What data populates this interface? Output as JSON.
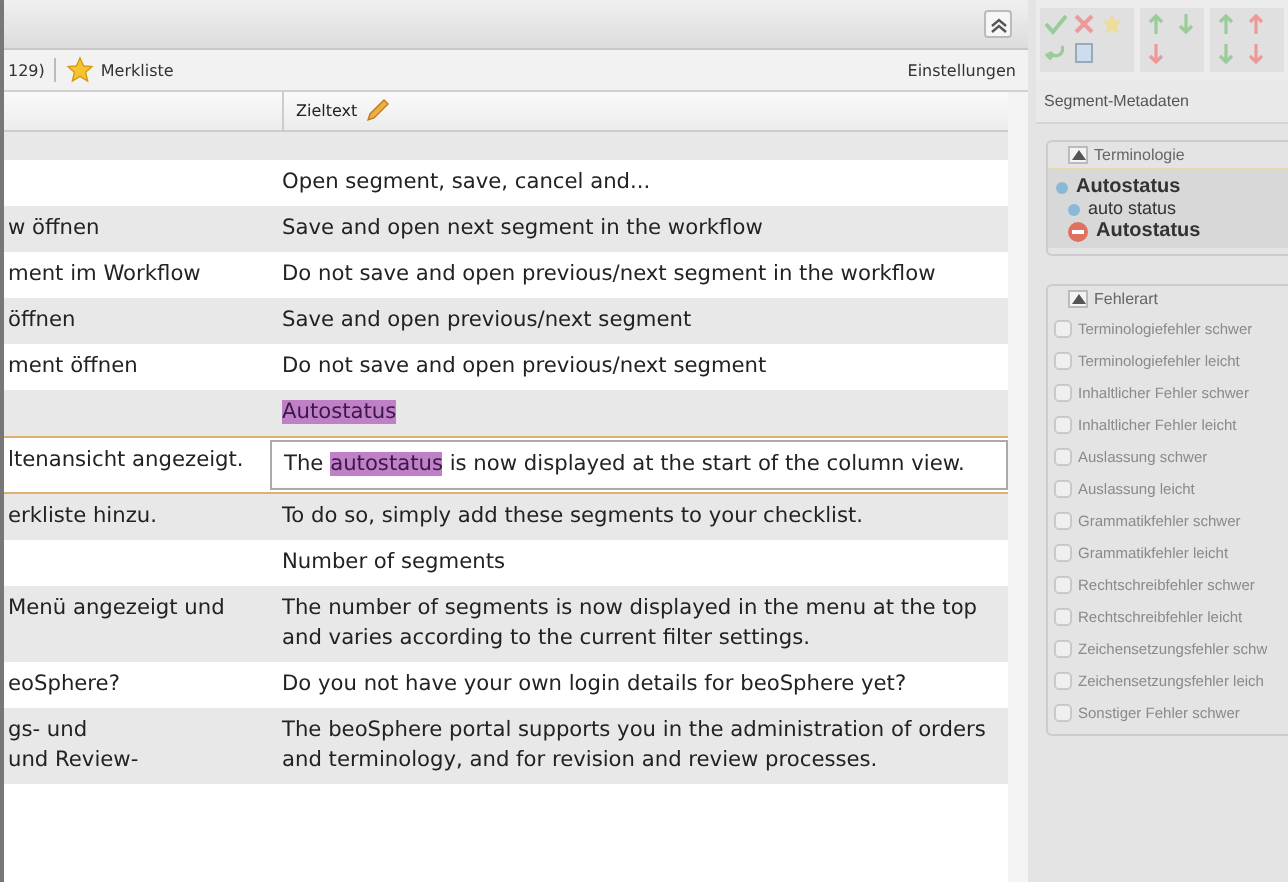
{
  "toolbar": {
    "count": "129)",
    "bookmark": "Merkliste",
    "settings": "Einstellungen"
  },
  "table": {
    "target_header": "Zieltext",
    "rows": [
      {
        "source": [],
        "target": [
          [
            {
              "text": "Open segment, save, cancel and...",
              "highlight": false
            }
          ]
        ],
        "selected": false
      },
      {
        "source": [
          "w öffnen"
        ],
        "target": [
          [
            {
              "text": "Save and open next segment in the workflow",
              "highlight": false
            }
          ]
        ],
        "selected": false
      },
      {
        "source": [
          "ment im Workflow"
        ],
        "target": [
          [
            {
              "text": "Do not save and open previous/next segment in the workflow",
              "highlight": false
            }
          ]
        ],
        "selected": false
      },
      {
        "source": [
          "öffnen"
        ],
        "target": [
          [
            {
              "text": "Save and open previous/next segment",
              "highlight": false
            }
          ]
        ],
        "selected": false
      },
      {
        "source": [
          "ment öffnen"
        ],
        "target": [
          [
            {
              "text": "Do not save and open previous/next segment",
              "highlight": false
            }
          ]
        ],
        "selected": false
      },
      {
        "source": [],
        "target": [
          [
            {
              "text": "Autostatus",
              "highlight": true
            }
          ]
        ],
        "selected": false
      },
      {
        "source": [
          "ltenansicht angezeigt."
        ],
        "target": [
          [
            {
              "text": "The ",
              "highlight": false
            },
            {
              "text": "autostatus",
              "highlight": true
            },
            {
              "text": " is now displayed at the start of the column view.",
              "highlight": false
            }
          ]
        ],
        "selected": true
      },
      {
        "source": [
          "erkliste hinzu."
        ],
        "target": [
          [
            {
              "text": "To do so, simply add these segments to your checklist.",
              "highlight": false
            }
          ]
        ],
        "selected": false
      },
      {
        "source": [],
        "target": [
          [
            {
              "text": "Number of segments",
              "highlight": false
            }
          ]
        ],
        "selected": false
      },
      {
        "source": [
          "Menü angezeigt und"
        ],
        "target": [
          [
            {
              "text": "The number of segments is now displayed in the menu at the top",
              "highlight": false
            }
          ],
          [
            {
              "text": "and varies according to the current filter settings.",
              "highlight": false
            }
          ]
        ],
        "selected": false
      },
      {
        "source": [
          "eoSphere?"
        ],
        "target": [
          [
            {
              "text": "Do you not have your own login details for beoSphere yet?",
              "highlight": false
            }
          ]
        ],
        "selected": false
      },
      {
        "source": [
          "gs- und",
          "und Review-"
        ],
        "target": [
          [
            {
              "text": "The beoSphere portal supports you in the administration of orders",
              "highlight": false
            }
          ],
          [
            {
              "text": "and terminology, and for revision and review processes.",
              "highlight": false
            }
          ]
        ],
        "selected": false
      }
    ]
  },
  "sidebar": {
    "title": "Segment-Metadaten",
    "terminology": {
      "legend": "Terminologie",
      "terms": [
        {
          "text": "Autostatus",
          "kind": "main"
        },
        {
          "text": "auto status",
          "kind": "allowed"
        },
        {
          "text": "Autostatus",
          "kind": "forbidden"
        }
      ]
    },
    "errors": {
      "legend": "Fehlerart",
      "items": [
        {
          "label": "Terminologiefehler schwer",
          "checked": false,
          "disabled": true
        },
        {
          "label": "Terminologiefehler leicht",
          "checked": false,
          "disabled": true
        },
        {
          "label": "Inhaltlicher Fehler schwer",
          "checked": false,
          "disabled": true
        },
        {
          "label": "Inhaltlicher Fehler leicht",
          "checked": false,
          "disabled": true
        },
        {
          "label": "Auslassung schwer",
          "checked": false,
          "disabled": true
        },
        {
          "label": "Auslassung leicht",
          "checked": false,
          "disabled": true
        },
        {
          "label": "Grammatikfehler schwer",
          "checked": false,
          "disabled": true
        },
        {
          "label": "Grammatikfehler leicht",
          "checked": false,
          "disabled": true
        },
        {
          "label": "Rechtschreibfehler schwer",
          "checked": false,
          "disabled": true
        },
        {
          "label": "Rechtschreibfehler leicht",
          "checked": false,
          "disabled": true
        },
        {
          "label": "Zeichensetzungsfehler schw",
          "checked": false,
          "disabled": true
        },
        {
          "label": "Zeichensetzungsfehler leich",
          "checked": false,
          "disabled": true
        },
        {
          "label": "Sonstiger Fehler schwer",
          "checked": false,
          "disabled": true
        }
      ]
    }
  }
}
